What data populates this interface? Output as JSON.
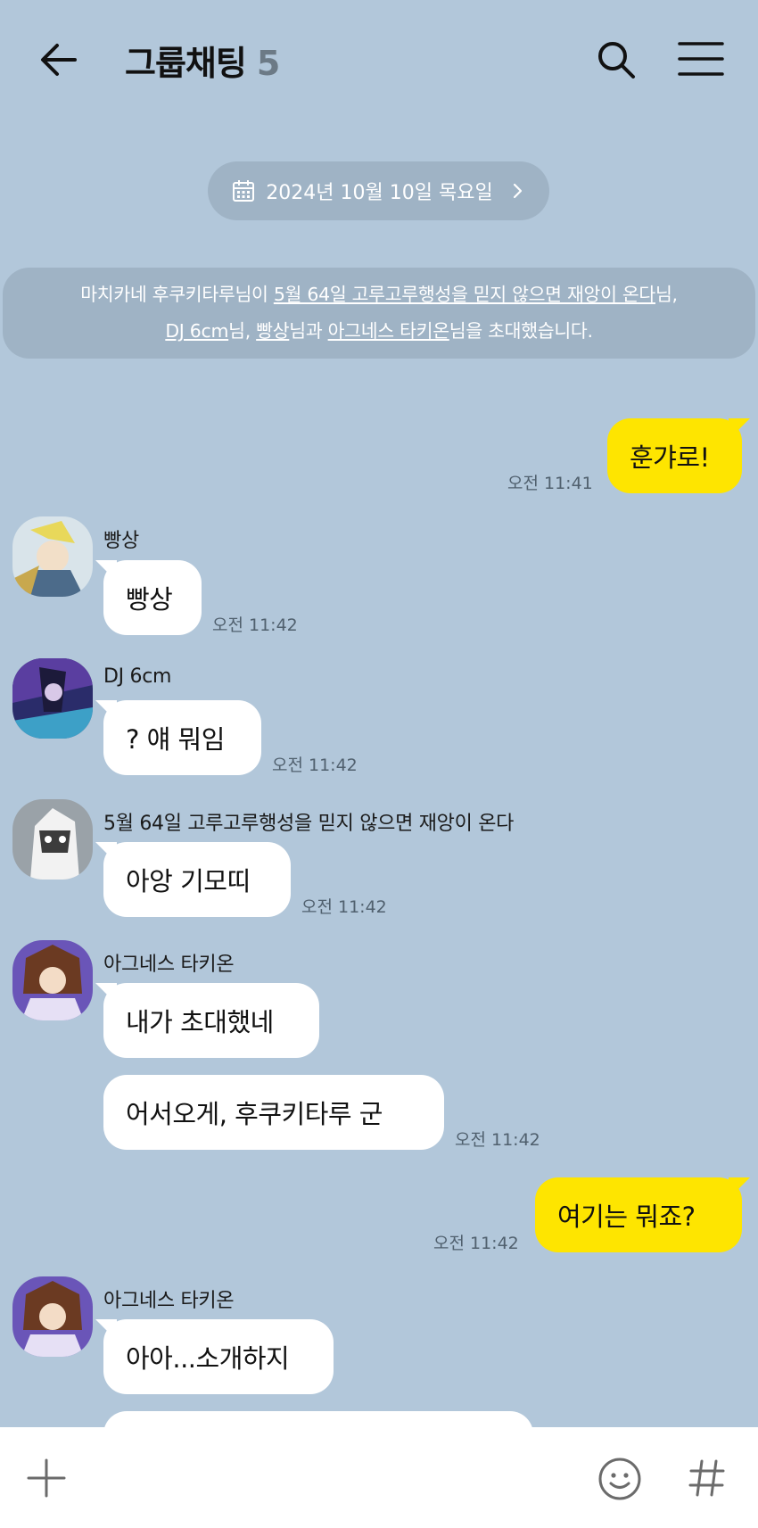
{
  "header": {
    "title": "그룹채팅",
    "member_count": "5",
    "icons": [
      "arrow-left-icon",
      "search-icon",
      "hamburger-menu-icon"
    ]
  },
  "date_divider": {
    "label": "2024년 10월 10일 목요일",
    "icons": [
      "calendar-icon",
      "chevron-right-icon"
    ]
  },
  "system_notice": {
    "part1": "마치카네 후쿠키타루님이 ",
    "link1": "5월 64일 고루고루행성을 믿지 않으면 재앙이 온다",
    "part2": "님,",
    "link2": "DJ 6cm",
    "part3": "님, ",
    "link3": "빵상",
    "part4": "님과 ",
    "link4": "아그네스 타키온",
    "part5": "님을 초대했습니다."
  },
  "messages": [
    {
      "sender": "me",
      "text": "훈갸로!",
      "time": "오전 11:41"
    },
    {
      "sender": "빵상",
      "text": "빵상",
      "time": "오전 11:42"
    },
    {
      "sender": "DJ 6cm",
      "text": "? 얘 뭐임",
      "time": "오전 11:42"
    },
    {
      "sender": "5월 64일 고루고루행성을 믿지 않으면 재앙이 온다",
      "text": "아앙 기모띠",
      "time": "오전 11:42"
    },
    {
      "sender": "아그네스 타키온",
      "text": "내가 초대했네"
    },
    {
      "sender": "아그네스 타키온",
      "text": "어서오게, 후쿠키타루 군",
      "time": "오전 11:42"
    },
    {
      "sender": "me",
      "text": "여기는 뭐죠?",
      "time": "오전 11:42"
    },
    {
      "sender": "아그네스 타키온",
      "text": "아아...소개하지"
    }
  ],
  "input_bar": {
    "icons": [
      "plus-icon",
      "emoji-icon",
      "hashtag-icon"
    ]
  },
  "colors": {
    "background": "#b2c7da",
    "my_bubble": "#fee500",
    "other_bubble": "#ffffff",
    "notice_pill": "#9fb3c5"
  }
}
